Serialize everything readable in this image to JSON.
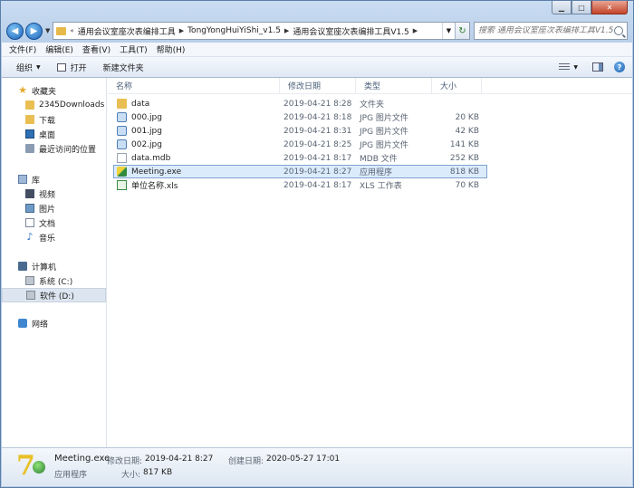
{
  "address": {
    "prefix": "«",
    "crumbs": [
      "通用会议室座次表编排工具",
      "TongYongHuiYiShi_v1.5",
      "通用会议室座次表编排工具V1.5"
    ]
  },
  "search": {
    "placeholder": "搜索 通用会议室座次表编排工具V1.5"
  },
  "menu": [
    "文件(F)",
    "编辑(E)",
    "查看(V)",
    "工具(T)",
    "帮助(H)"
  ],
  "toolbar": {
    "organize": "组织",
    "open": "打开",
    "new_folder": "新建文件夹"
  },
  "nav": {
    "favorites": {
      "label": "收藏夹",
      "items": [
        "2345Downloads",
        "下载",
        "桌面",
        "最近访问的位置"
      ]
    },
    "libraries": {
      "label": "库",
      "items": [
        "视频",
        "图片",
        "文档",
        "音乐"
      ]
    },
    "computer": {
      "label": "计算机",
      "items": [
        "系统 (C:)",
        "软件 (D:)"
      ]
    },
    "network": {
      "label": "网络"
    }
  },
  "columns": {
    "name": "名称",
    "date": "修改日期",
    "type": "类型",
    "size": "大小"
  },
  "files": [
    {
      "name": "data",
      "date": "2019-04-21 8:28",
      "type": "文件夹",
      "size": "",
      "icon": "folder-icon"
    },
    {
      "name": "000.jpg",
      "date": "2019-04-21 8:18",
      "type": "JPG 图片文件",
      "size": "20 KB",
      "icon": "jpg-icon"
    },
    {
      "name": "001.jpg",
      "date": "2019-04-21 8:31",
      "type": "JPG 图片文件",
      "size": "42 KB",
      "icon": "jpg-icon"
    },
    {
      "name": "002.jpg",
      "date": "2019-04-21 8:25",
      "type": "JPG 图片文件",
      "size": "141 KB",
      "icon": "jpg-icon"
    },
    {
      "name": "data.mdb",
      "date": "2019-04-21 8:17",
      "type": "MDB 文件",
      "size": "252 KB",
      "icon": "mdb-icon"
    },
    {
      "name": "Meeting.exe",
      "date": "2019-04-21 8:27",
      "type": "应用程序",
      "size": "818 KB",
      "icon": "exe-icon"
    },
    {
      "name": "单位名称.xls",
      "date": "2019-04-21 8:17",
      "type": "XLS 工作表",
      "size": "70 KB",
      "icon": "xls-icon"
    }
  ],
  "details": {
    "name": "Meeting.exe",
    "modified_label": "修改日期:",
    "modified": "2019-04-21 8:27",
    "created_label": "创建日期:",
    "created": "2020-05-27 17:01",
    "type": "应用程序",
    "size_label": "大小:",
    "size": "817 KB"
  }
}
